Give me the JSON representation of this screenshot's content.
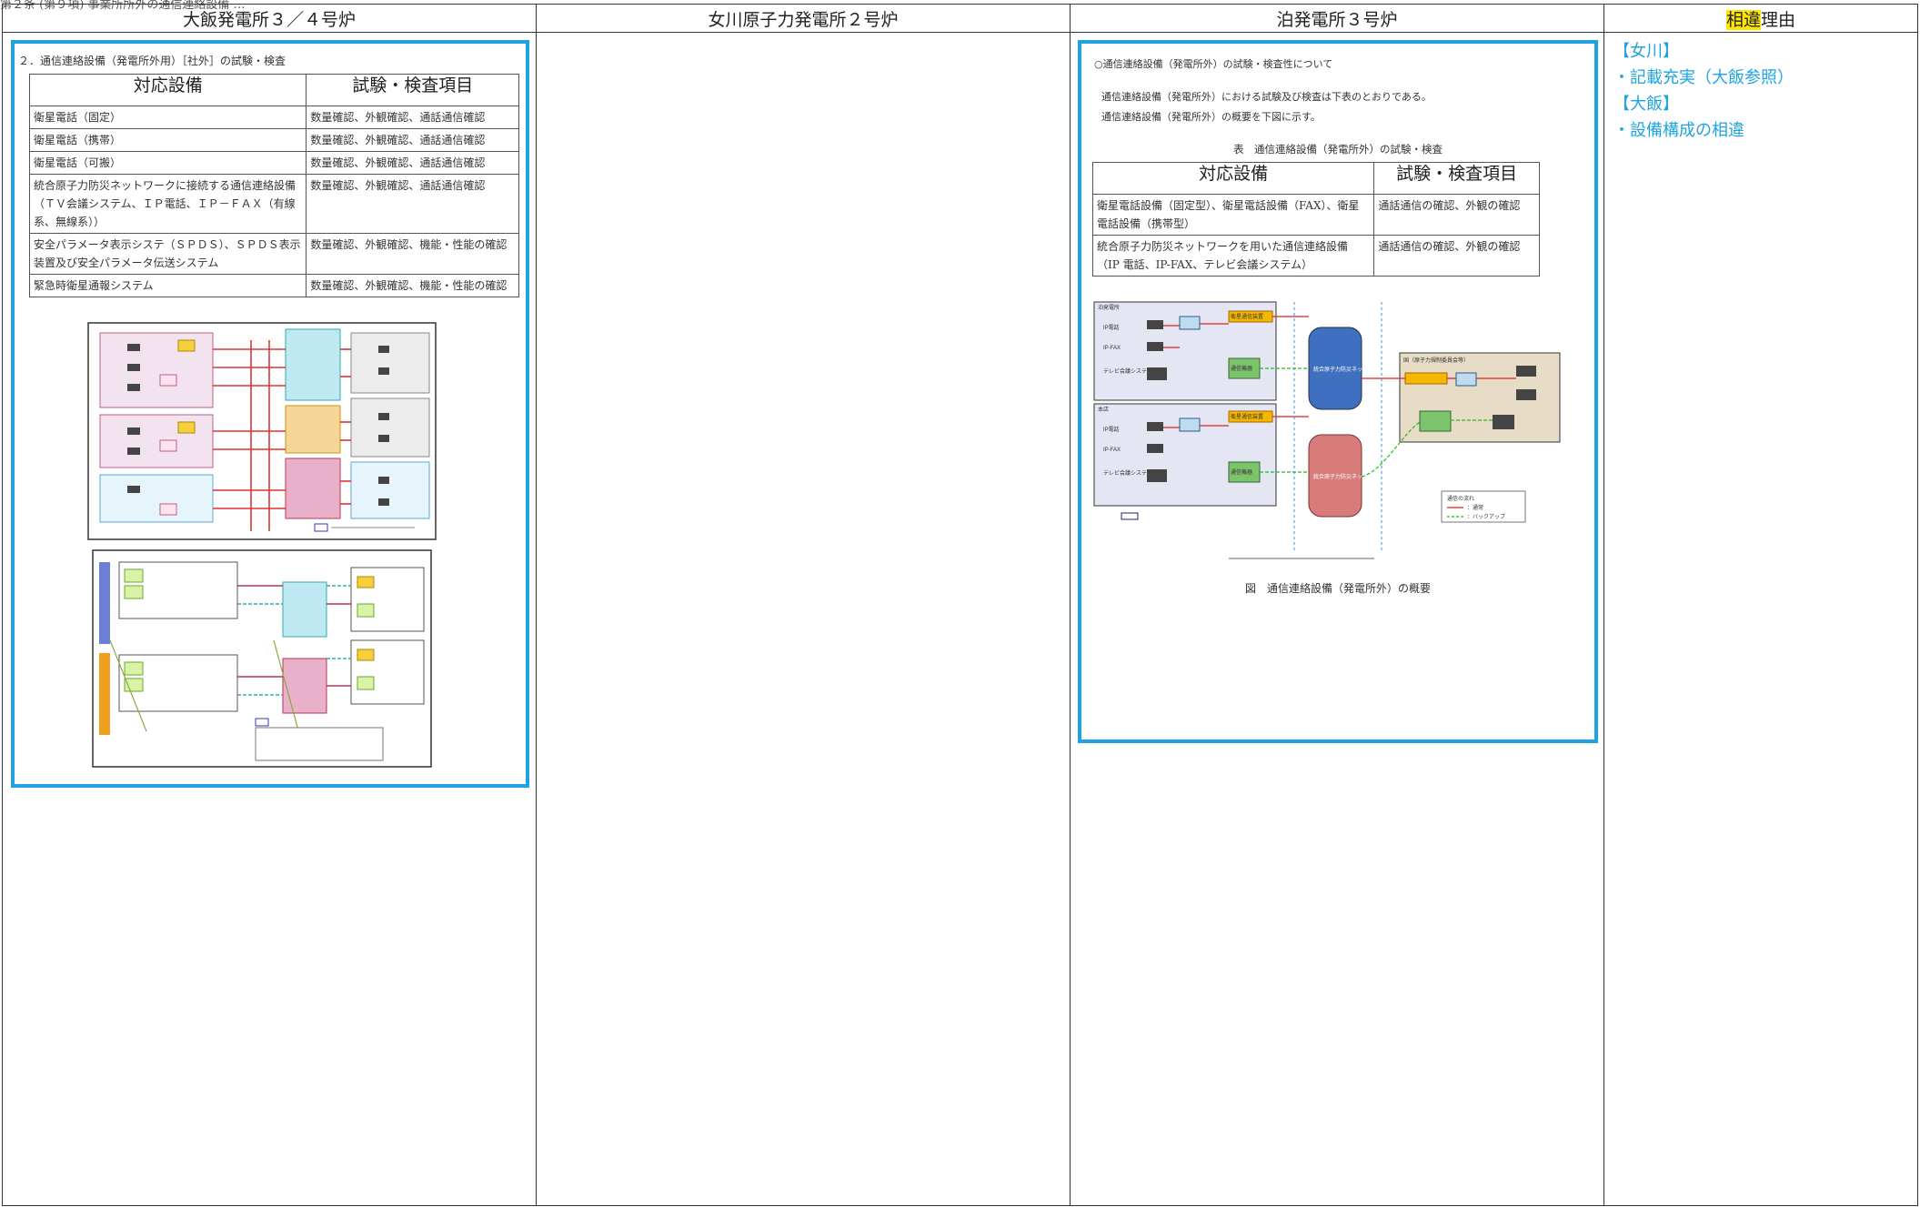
{
  "top_clipped_text": "第２条 (第９項) 事業所所外の通信連絡設備 …",
  "headers": {
    "col_ohi": "大飯発電所３／４号炉",
    "col_onagawa": "女川原子力発電所２号炉",
    "col_tomari": "泊発電所３号炉",
    "col_reason_hl": "相違",
    "col_reason_rest": "理由"
  },
  "ohi": {
    "section_title": "２．通信連絡設備（発電所外用）［社外］の試験・検査",
    "table_headers": [
      "対応設備",
      "試験・検査項目"
    ],
    "rows": [
      [
        "衛星電話（固定）",
        "数量確認、外観確認、通話通信確認"
      ],
      [
        "衛星電話（携帯）",
        "数量確認、外観確認、通話通信確認"
      ],
      [
        "衛星電話（可搬）",
        "数量確認、外観確認、通話通信確認"
      ],
      [
        "統合原子力防災ネットワークに接続する通信連絡設備（ＴＶ会議システム、ＩＰ電話、ＩＰ－ＦＡＸ（有線系、無線系））",
        "数量確認、外観確認、通話通信確認"
      ],
      [
        "安全パラメータ表示システ（ＳＰＤＳ）、ＳＰＤＳ表示装置及び安全パラメータ伝送システム",
        "数量確認、外観確認、機能・性能の確認"
      ],
      [
        "緊急時衛星通報システム",
        "数量確認、外観確認、機能・性能の確認"
      ]
    ]
  },
  "tomari": {
    "title": "○通信連絡設備（発電所外）の試験・検査性について",
    "para1": "通信連絡設備（発電所外）における試験及び検査は下表のとおりである。",
    "para2": "通信連絡設備（発電所外）の概要を下図に示す。",
    "table_caption": "表　通信連絡設備（発電所外）の試験・検査",
    "table_headers": [
      "対応設備",
      "試験・検査項目"
    ],
    "rows": [
      [
        "衛星電話設備（固定型）、衛星電話設備（FAX）、衛星電話設備（携帯型）",
        "通話通信の確認、外観の確認"
      ],
      [
        "統合原子力防災ネットワークを用いた通信連絡設備（IP 電話、IP-FAX、テレビ会議システム）",
        "通話通信の確認、外観の確認"
      ]
    ],
    "figure_caption": "図　通信連絡設備（発電所外）の概要",
    "diagram": {
      "box_plant": "泊発電所",
      "box_hq": "本店",
      "label_ip_phone": "IP電話",
      "label_ip_fax": "IP-FAX",
      "label_tv": "テレビ会議システム",
      "label_sat": "衛星通信装置",
      "label_comm": "通信機器",
      "label_net_wired": "統合原子力防災ネットワーク（有線系回線）",
      "label_net_sat": "統合原子力防災ネットワーク（衛星系回線）",
      "label_gov": "国（原子力規制委員会等）",
      "legend_title": "通信の流れ",
      "legend_normal": "：通常",
      "legend_backup": "：バックアップ"
    }
  },
  "reasons": [
    "【女川】",
    "・記載充実（大飯参照）",
    "【大飯】",
    "・設備構成の相違"
  ]
}
